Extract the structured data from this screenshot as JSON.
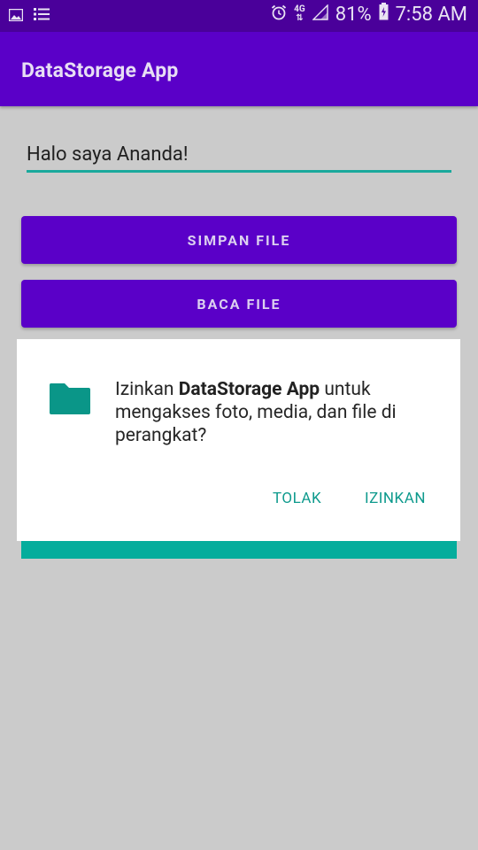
{
  "status_bar": {
    "network_label": "4G",
    "battery_percent": "81%",
    "time": "7:58 AM",
    "icons": [
      "image-icon",
      "list-icon",
      "alarm-icon",
      "data-arrows-icon",
      "signal-icon",
      "battery-charging-icon"
    ]
  },
  "app_bar": {
    "title": "DataStorage App"
  },
  "edit": {
    "value": "Halo saya Ananda!"
  },
  "buttons": {
    "save": "SIMPAN FILE",
    "read": "BACA FILE"
  },
  "dialog": {
    "prefix": "Izinkan ",
    "app_name": "DataStorage App",
    "suffix": " untuk mengakses foto, media, dan file di perangkat?",
    "deny_label": "TOLAK",
    "allow_label": "IZINKAN",
    "icon": "folder-icon"
  },
  "colors": {
    "primary": "#5a00c8",
    "status_bar": "#4a009a",
    "accent": "#05ad9c",
    "scrim_background": "#cbcbcb"
  }
}
